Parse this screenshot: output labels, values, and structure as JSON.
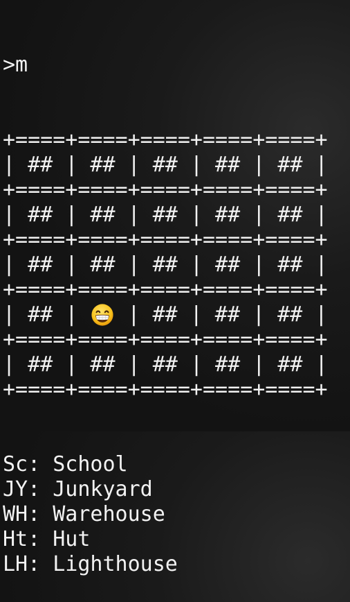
{
  "prompt": ">m",
  "border_row": "+====+====+====+====+====+",
  "grid": [
    [
      "##",
      "##",
      "##",
      "##",
      "##"
    ],
    [
      "##",
      "##",
      "##",
      "##",
      "##"
    ],
    [
      "##",
      "##",
      "##",
      "##",
      "##"
    ],
    [
      "##",
      "grinning-face-emoji",
      "##",
      "##",
      "##"
    ],
    [
      "##",
      "##",
      "##",
      "##",
      "##"
    ]
  ],
  "legend": [
    "Sc: School",
    "JY: Junkyard",
    "WH: Warehouse",
    "Ht: Hut",
    "LH: Lighthouse"
  ]
}
